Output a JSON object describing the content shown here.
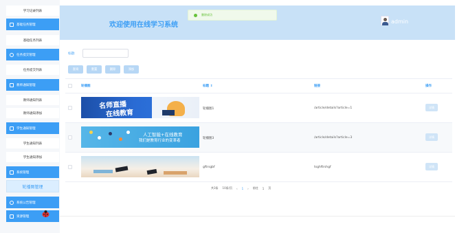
{
  "sidebar": {
    "items": [
      {
        "label": "学习记录列表",
        "kind": "item"
      },
      {
        "label": "基础任务管理",
        "kind": "group"
      },
      {
        "label": "基础任务列表",
        "kind": "item"
      },
      {
        "label": "任务提交管理",
        "kind": "group"
      },
      {
        "label": "任务提交列表",
        "kind": "item"
      },
      {
        "label": "教师通知管理",
        "kind": "group"
      },
      {
        "label": "教师通知列表",
        "kind": "item"
      },
      {
        "label": "教师通知添加",
        "kind": "item"
      },
      {
        "label": "学生通知管理",
        "kind": "group"
      },
      {
        "label": "学生通知列表",
        "kind": "item"
      },
      {
        "label": "学生通知添加",
        "kind": "item"
      },
      {
        "label": "系统管理",
        "kind": "group"
      },
      {
        "label": "轮播图管理",
        "kind": "active"
      },
      {
        "label": "系统公告管理",
        "kind": "group"
      },
      {
        "label": "资源管理",
        "kind": "group"
      }
    ]
  },
  "header": {
    "welcome": "欢迎使用在线学习系统",
    "toast": "删除成功",
    "username": "admin"
  },
  "search": {
    "label": "标题:",
    "placeholder": "",
    "buttons": {
      "search": "查询",
      "reset": "重置",
      "delete": "删除",
      "add": "添加"
    }
  },
  "table": {
    "columns": {
      "image": "轮播图",
      "title": "标题 ⇕",
      "link": "链接",
      "action": "操作"
    },
    "rows": [
      {
        "title": "轮播图1",
        "link": "/article/details?article=1",
        "action": "详情"
      },
      {
        "title": "轮播图3",
        "link": "/article/details?article=3",
        "action": "详情"
      },
      {
        "title": "gftrsgbf",
        "link": "tsghftrshgf",
        "action": "详情"
      }
    ],
    "images": {
      "img1_line1": "名师直播",
      "img1_line2": "在线教育",
      "img2_line1": "人工智能+在线教育",
      "img2_line2": "我们是教育行业的变革者"
    }
  },
  "pager": {
    "total": "共3条",
    "per_page": "10条/页",
    "prev": "‹",
    "current": "1",
    "next": "›",
    "goto_label": "前往",
    "goto_value": "1",
    "page_suffix": "页"
  },
  "colors": {
    "accent": "#3c9ef5",
    "header_bg": "#c8e1f7",
    "success": "#67c23a"
  }
}
